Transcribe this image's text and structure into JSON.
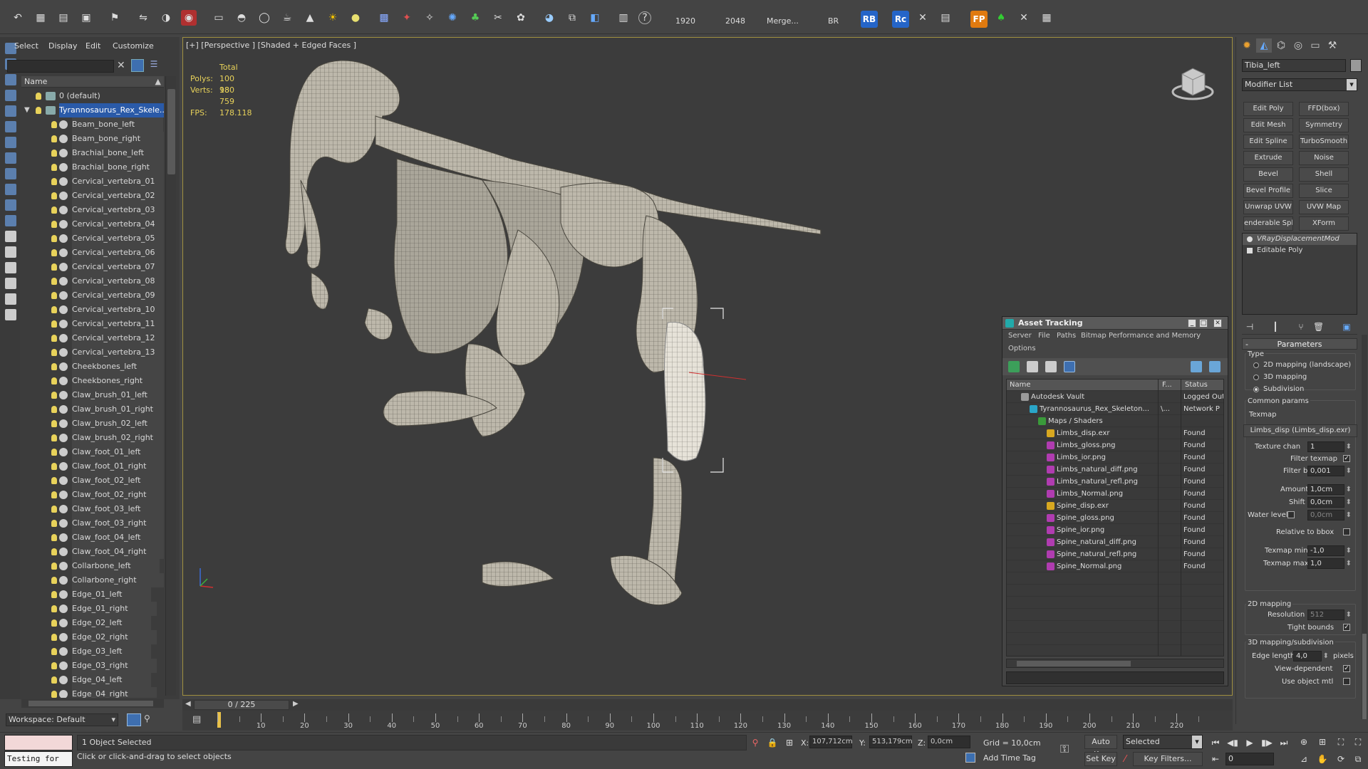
{
  "toolbar": {
    "res_width": "1920",
    "res_height": "2048",
    "merge": "Merge...",
    "br": "BR",
    "rb": "RB",
    "rc": "Rc",
    "fp": "FP",
    "help": "?"
  },
  "explorer": {
    "menu": [
      "Select",
      "Display",
      "Edit",
      "Customize"
    ],
    "column_header": "Name",
    "layer_default": "0 (default)",
    "layer_selected": "Tyrannosaurus_Rex_Skele...",
    "items": [
      "Beam_bone_left",
      "Beam_bone_right",
      "Brachial_bone_left",
      "Brachial_bone_right",
      "Cervical_vertebra_01",
      "Cervical_vertebra_02",
      "Cervical_vertebra_03",
      "Cervical_vertebra_04",
      "Cervical_vertebra_05",
      "Cervical_vertebra_06",
      "Cervical_vertebra_07",
      "Cervical_vertebra_08",
      "Cervical_vertebra_09",
      "Cervical_vertebra_10",
      "Cervical_vertebra_11",
      "Cervical_vertebra_12",
      "Cervical_vertebra_13",
      "Cheekbones_left",
      "Cheekbones_right",
      "Claw_brush_01_left",
      "Claw_brush_01_right",
      "Claw_brush_02_left",
      "Claw_brush_02_right",
      "Claw_foot_01_left",
      "Claw_foot_01_right",
      "Claw_foot_02_left",
      "Claw_foot_02_right",
      "Claw_foot_03_left",
      "Claw_foot_03_right",
      "Claw_foot_04_left",
      "Claw_foot_04_right",
      "Collarbone_left",
      "Collarbone_right",
      "Edge_01_left",
      "Edge_01_right",
      "Edge_02_left",
      "Edge_02_right",
      "Edge_03_left",
      "Edge_03_right",
      "Edge_04_left",
      "Edge_04_right"
    ],
    "workspace": "Workspace: Default"
  },
  "viewport": {
    "label": "[+] [Perspective ] [Shaded + Edged Faces ]",
    "stats_total": "Total",
    "polys_label": "Polys:",
    "polys_value": "100 180",
    "verts_label": "Verts:",
    "verts_value": "98 759",
    "fps_label": "FPS:",
    "fps_value": "178.118"
  },
  "asset_tracking": {
    "title": "Asset Tracking",
    "menu": [
      "Server",
      "File",
      "Paths",
      "Bitmap Performance and Memory",
      "Options"
    ],
    "columns": [
      "Name",
      "F...",
      "Status"
    ],
    "rows": [
      {
        "name": "Autodesk Vault",
        "f": "",
        "status": "Logged Out",
        "indent": 1,
        "icon": "vault-icon",
        "icolor": "#9a9a9a"
      },
      {
        "name": "Tyrannosaurus_Rex_Skeleton...",
        "f": "\\...",
        "status": "Network P",
        "indent": 2,
        "icon": "max-file-icon",
        "icolor": "#2aa6c8"
      },
      {
        "name": "Maps / Shaders",
        "f": "",
        "status": "",
        "indent": 3,
        "icon": "maps-folder-icon",
        "icolor": "#3a9a3a"
      },
      {
        "name": "Limbs_disp.exr",
        "f": "",
        "status": "Found",
        "indent": 4,
        "icon": "exr-file-icon",
        "icolor": "#d8a820"
      },
      {
        "name": "Limbs_gloss.png",
        "f": "",
        "status": "Found",
        "indent": 4,
        "icon": "png-file-icon",
        "icolor": "#b03cb0"
      },
      {
        "name": "Limbs_ior.png",
        "f": "",
        "status": "Found",
        "indent": 4,
        "icon": "png-file-icon",
        "icolor": "#b03cb0"
      },
      {
        "name": "Limbs_natural_diff.png",
        "f": "",
        "status": "Found",
        "indent": 4,
        "icon": "png-file-icon",
        "icolor": "#b03cb0"
      },
      {
        "name": "Limbs_natural_refl.png",
        "f": "",
        "status": "Found",
        "indent": 4,
        "icon": "png-file-icon",
        "icolor": "#b03cb0"
      },
      {
        "name": "Limbs_Normal.png",
        "f": "",
        "status": "Found",
        "indent": 4,
        "icon": "png-file-icon",
        "icolor": "#b03cb0"
      },
      {
        "name": "Spine_disp.exr",
        "f": "",
        "status": "Found",
        "indent": 4,
        "icon": "exr-file-icon",
        "icolor": "#d8a820"
      },
      {
        "name": "Spine_gloss.png",
        "f": "",
        "status": "Found",
        "indent": 4,
        "icon": "png-file-icon",
        "icolor": "#b03cb0"
      },
      {
        "name": "Spine_ior.png",
        "f": "",
        "status": "Found",
        "indent": 4,
        "icon": "png-file-icon",
        "icolor": "#b03cb0"
      },
      {
        "name": "Spine_natural_diff.png",
        "f": "",
        "status": "Found",
        "indent": 4,
        "icon": "png-file-icon",
        "icolor": "#b03cb0"
      },
      {
        "name": "Spine_natural_refl.png",
        "f": "",
        "status": "Found",
        "indent": 4,
        "icon": "png-file-icon",
        "icolor": "#b03cb0"
      },
      {
        "name": "Spine_Normal.png",
        "f": "",
        "status": "Found",
        "indent": 4,
        "icon": "png-file-icon",
        "icolor": "#b03cb0"
      }
    ]
  },
  "command_panel": {
    "object_name": "Tibia_left",
    "modifier_list": "Modifier List",
    "buttons": [
      [
        "Edit Poly",
        "FFD(box)"
      ],
      [
        "Edit Mesh",
        "Symmetry"
      ],
      [
        "Edit Spline",
        "TurboSmooth"
      ],
      [
        "Extrude",
        "Noise"
      ],
      [
        "Bevel",
        "Shell"
      ],
      [
        "Bevel Profile",
        "Slice"
      ],
      [
        "Unwrap UVW",
        "UVW Map"
      ],
      [
        "enderable Splir",
        "XForm"
      ]
    ],
    "stack": [
      "VRayDisplacementMod",
      "Editable Poly"
    ],
    "params_title": "Parameters",
    "type_label": "Type",
    "radio_2d": "2D mapping (landscape)",
    "radio_3d": "3D mapping",
    "radio_subdiv": "Subdivision",
    "common_params": "Common params",
    "texmap_label": "Texmap",
    "texmap_value": "Limbs_disp (Limbs_disp.exr)",
    "texture_chan_label": "Texture chan",
    "texture_chan_value": "1",
    "filter_texmap_label": "Filter texmap",
    "filter_blur_label": "Filter blur",
    "filter_blur_value": "0,001",
    "amount_label": "Amount",
    "amount_value": "1,0cm",
    "shift_label": "Shift",
    "shift_value": "0,0cm",
    "water_level_label": "Water level",
    "water_level_value": "0,0cm",
    "relative_bbox_label": "Relative to bbox",
    "texmap_min_label": "Texmap min",
    "texmap_min_value": "-1,0",
    "texmap_max_label": "Texmap max",
    "texmap_max_value": "1,0",
    "mapping2d_label": "2D mapping",
    "resolution_label": "Resolution",
    "resolution_value": "512",
    "tight_bounds_label": "Tight bounds",
    "mapping3d_label": "3D mapping/subdivision",
    "edge_length_label": "Edge length",
    "edge_length_value": "4,0",
    "pixels_label": "pixels",
    "view_dependent_label": "View-dependent",
    "use_object_mtl_label": "Use object mtl"
  },
  "timeline": {
    "frame_counter": "0 / 225",
    "ticks": [
      "10",
      "20",
      "30",
      "40",
      "50",
      "60",
      "70",
      "80",
      "90",
      "100",
      "110",
      "120",
      "130",
      "140",
      "150",
      "160",
      "170",
      "180",
      "190",
      "200",
      "210",
      "220"
    ]
  },
  "statusbar": {
    "script_text": "Testing for",
    "selection": "1 Object Selected",
    "prompt": "Click or click-and-drag to select objects",
    "x_value": "107,712cm",
    "y_value": "513,179cm",
    "z_value": "0,0cm",
    "grid": "Grid = 10,0cm",
    "add_time_tag": "Add Time Tag",
    "auto_key": "Auto Key",
    "set_key": "Set Key",
    "selected": "Selected",
    "key_filters": "Key Filters...",
    "frame": "0"
  }
}
